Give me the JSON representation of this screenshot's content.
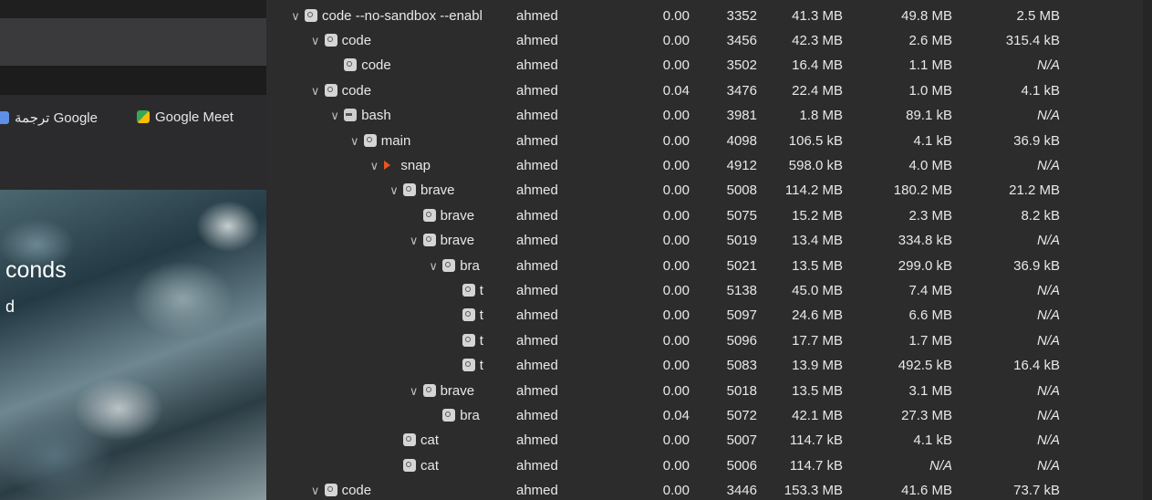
{
  "browser": {
    "bookmarks": [
      {
        "label": "ترجمة Google",
        "icon": "google-translate-icon"
      },
      {
        "label": "Google Meet",
        "icon": "google-meet-icon"
      }
    ],
    "wallpaper_text": [
      "conds",
      "d"
    ]
  },
  "process_table": {
    "rows": [
      {
        "name": "code --no-sandbox --enabl",
        "user": "ahmed",
        "cpu": "0.00",
        "pid": "3352",
        "memory": "41.3 MB",
        "disk_read": "49.8 MB",
        "disk_write": "2.5 MB",
        "depth": 0,
        "expanded": true,
        "icon": "process-icon"
      },
      {
        "name": "code",
        "user": "ahmed",
        "cpu": "0.00",
        "pid": "3456",
        "memory": "42.3 MB",
        "disk_read": "2.6 MB",
        "disk_write": "315.4 kB",
        "depth": 1,
        "expanded": true,
        "icon": "process-icon"
      },
      {
        "name": "code",
        "user": "ahmed",
        "cpu": "0.00",
        "pid": "3502",
        "memory": "16.4 MB",
        "disk_read": "1.1 MB",
        "disk_write": "N/A",
        "depth": 2,
        "expanded": null,
        "icon": "process-icon"
      },
      {
        "name": "code",
        "user": "ahmed",
        "cpu": "0.04",
        "pid": "3476",
        "memory": "22.4 MB",
        "disk_read": "1.0 MB",
        "disk_write": "4.1 kB",
        "depth": 1,
        "expanded": true,
        "icon": "process-icon"
      },
      {
        "name": "bash",
        "user": "ahmed",
        "cpu": "0.00",
        "pid": "3981",
        "memory": "1.8 MB",
        "disk_read": "89.1 kB",
        "disk_write": "N/A",
        "depth": 2,
        "expanded": true,
        "icon": "terminal-icon"
      },
      {
        "name": "main",
        "user": "ahmed",
        "cpu": "0.00",
        "pid": "4098",
        "memory": "106.5 kB",
        "disk_read": "4.1 kB",
        "disk_write": "36.9 kB",
        "depth": 3,
        "expanded": true,
        "icon": "process-icon"
      },
      {
        "name": "snap",
        "user": "ahmed",
        "cpu": "0.00",
        "pid": "4912",
        "memory": "598.0 kB",
        "disk_read": "4.0 MB",
        "disk_write": "N/A",
        "depth": 4,
        "expanded": true,
        "icon": "snap-icon"
      },
      {
        "name": "brave",
        "user": "ahmed",
        "cpu": "0.00",
        "pid": "5008",
        "memory": "114.2 MB",
        "disk_read": "180.2 MB",
        "disk_write": "21.2 MB",
        "depth": 5,
        "expanded": true,
        "icon": "process-icon"
      },
      {
        "name": "brave",
        "user": "ahmed",
        "cpu": "0.00",
        "pid": "5075",
        "memory": "15.2 MB",
        "disk_read": "2.3 MB",
        "disk_write": "8.2 kB",
        "depth": 6,
        "expanded": null,
        "icon": "process-icon"
      },
      {
        "name": "brave",
        "user": "ahmed",
        "cpu": "0.00",
        "pid": "5019",
        "memory": "13.4 MB",
        "disk_read": "334.8 kB",
        "disk_write": "N/A",
        "depth": 6,
        "expanded": true,
        "icon": "process-icon"
      },
      {
        "name": "bra",
        "user": "ahmed",
        "cpu": "0.00",
        "pid": "5021",
        "memory": "13.5 MB",
        "disk_read": "299.0 kB",
        "disk_write": "36.9 kB",
        "depth": 7,
        "expanded": true,
        "icon": "process-icon"
      },
      {
        "name": "t",
        "user": "ahmed",
        "cpu": "0.00",
        "pid": "5138",
        "memory": "45.0 MB",
        "disk_read": "7.4 MB",
        "disk_write": "N/A",
        "depth": 8,
        "expanded": null,
        "icon": "process-icon"
      },
      {
        "name": "t",
        "user": "ahmed",
        "cpu": "0.00",
        "pid": "5097",
        "memory": "24.6 MB",
        "disk_read": "6.6 MB",
        "disk_write": "N/A",
        "depth": 8,
        "expanded": null,
        "icon": "process-icon"
      },
      {
        "name": "t",
        "user": "ahmed",
        "cpu": "0.00",
        "pid": "5096",
        "memory": "17.7 MB",
        "disk_read": "1.7 MB",
        "disk_write": "N/A",
        "depth": 8,
        "expanded": null,
        "icon": "process-icon"
      },
      {
        "name": "t",
        "user": "ahmed",
        "cpu": "0.00",
        "pid": "5083",
        "memory": "13.9 MB",
        "disk_read": "492.5 kB",
        "disk_write": "16.4 kB",
        "depth": 8,
        "expanded": null,
        "icon": "process-icon"
      },
      {
        "name": "brave",
        "user": "ahmed",
        "cpu": "0.00",
        "pid": "5018",
        "memory": "13.5 MB",
        "disk_read": "3.1 MB",
        "disk_write": "N/A",
        "depth": 6,
        "expanded": true,
        "icon": "process-icon"
      },
      {
        "name": "bra",
        "user": "ahmed",
        "cpu": "0.04",
        "pid": "5072",
        "memory": "42.1 MB",
        "disk_read": "27.3 MB",
        "disk_write": "N/A",
        "depth": 7,
        "expanded": null,
        "icon": "process-icon"
      },
      {
        "name": "cat",
        "user": "ahmed",
        "cpu": "0.00",
        "pid": "5007",
        "memory": "114.7 kB",
        "disk_read": "4.1 kB",
        "disk_write": "N/A",
        "depth": 5,
        "expanded": null,
        "icon": "process-icon"
      },
      {
        "name": "cat",
        "user": "ahmed",
        "cpu": "0.00",
        "pid": "5006",
        "memory": "114.7 kB",
        "disk_read": "N/A",
        "disk_write": "N/A",
        "depth": 5,
        "expanded": null,
        "icon": "process-icon"
      },
      {
        "name": "code",
        "user": "ahmed",
        "cpu": "0.00",
        "pid": "3446",
        "memory": "153.3 MB",
        "disk_read": "41.6 MB",
        "disk_write": "73.7 kB",
        "depth": 1,
        "expanded": true,
        "icon": "process-icon"
      }
    ]
  },
  "colors": {
    "panel_bg": "#2c2c2c",
    "text": "#e8e8e8",
    "snap_accent": "#e95420"
  }
}
